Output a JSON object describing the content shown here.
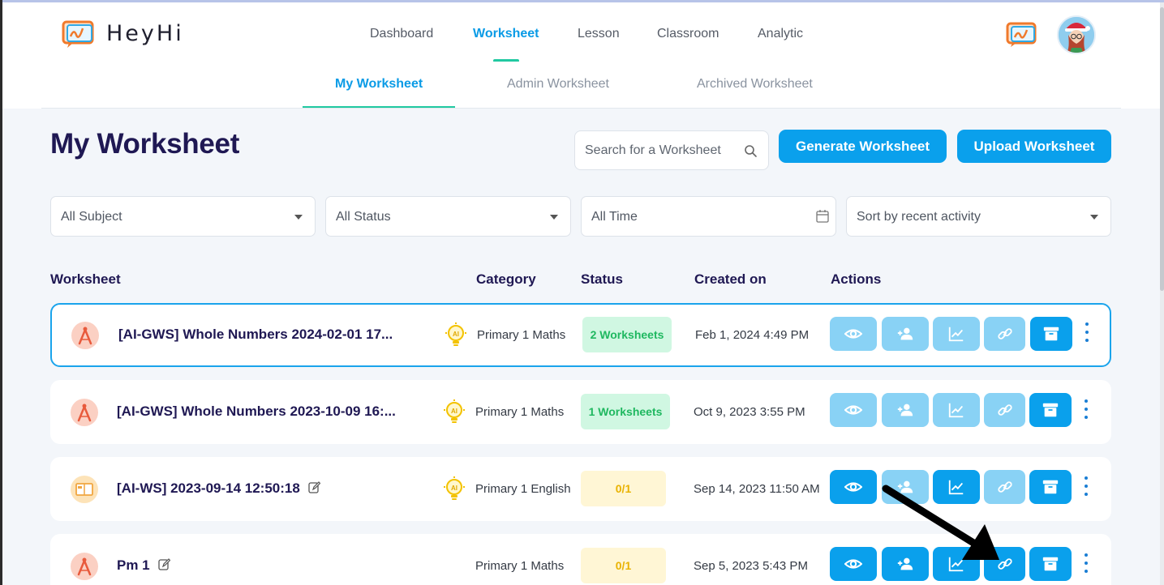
{
  "app": {
    "name": "HeyHi"
  },
  "nav": {
    "items": [
      {
        "label": "Dashboard"
      },
      {
        "label": "Worksheet"
      },
      {
        "label": "Lesson"
      },
      {
        "label": "Classroom"
      },
      {
        "label": "Analytic"
      }
    ],
    "active": "Worksheet"
  },
  "subtabs": {
    "items": [
      {
        "label": "My Worksheet"
      },
      {
        "label": "Admin Worksheet"
      },
      {
        "label": "Archived Worksheet"
      }
    ],
    "active": "My Worksheet"
  },
  "page": {
    "title": "My Worksheet"
  },
  "search": {
    "placeholder": "Search for a Worksheet"
  },
  "buttons": {
    "generate": "Generate Worksheet",
    "upload": "Upload Worksheet"
  },
  "filters": {
    "subject": "All Subject",
    "status": "All Status",
    "time": "All Time",
    "sort": "Sort by recent activity"
  },
  "table": {
    "headers": {
      "worksheet": "Worksheet",
      "category": "Category",
      "status": "Status",
      "created": "Created on",
      "actions": "Actions"
    },
    "rows": [
      {
        "title": "[AI-GWS] Whole Numbers 2024-02-01 17...",
        "category": "Primary 1 Maths",
        "status": "2 Worksheets",
        "created": "Feb 1, 2024 4:49 PM"
      },
      {
        "title": "[AI-GWS] Whole Numbers 2023-10-09 16:...",
        "category": "Primary 1 Maths",
        "status": "1 Worksheets",
        "created": "Oct 9, 2023 3:55 PM"
      },
      {
        "title": "[AI-WS] 2023-09-14 12:50:18",
        "category": "Primary 1 English",
        "status": "0/1",
        "created": "Sep 14, 2023 11:50 AM"
      },
      {
        "title": "Pm 1",
        "category": "Primary 1 Maths",
        "status": "0/1",
        "created": "Sep 5, 2023 5:43 PM"
      }
    ]
  },
  "colors": {
    "accent": "#0aa0ec",
    "accent_light": "#89d2f5",
    "nav_indicator": "#21c9a1",
    "title": "#1f1853",
    "status_green": "#1fb860",
    "status_yellow": "#e9b200"
  },
  "icons": {
    "row_type_math": "compass-icon",
    "row_type_english": "book-icon",
    "ai": "ai-bulb-icon",
    "actions": [
      "eye-icon",
      "add-user-icon",
      "chart-icon",
      "link-icon",
      "archive-icon",
      "more-vertical-icon"
    ]
  }
}
